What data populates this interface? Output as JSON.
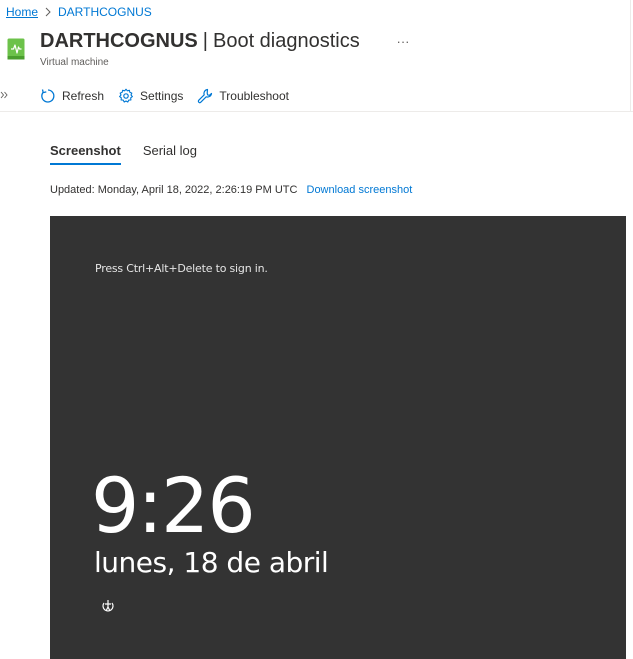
{
  "breadcrumb": {
    "home": "Home",
    "current": "DARTHCOGNUS"
  },
  "header": {
    "resource_name": "DARTHCOGNUS",
    "separator": "|",
    "page_name": "Boot diagnostics",
    "more": "···",
    "subtitle": "Virtual machine"
  },
  "toolbar": {
    "refresh": "Refresh",
    "settings": "Settings",
    "troubleshoot": "Troubleshoot"
  },
  "tabs": [
    {
      "label": "Screenshot",
      "active": true
    },
    {
      "label": "Serial log",
      "active": false
    }
  ],
  "updated": {
    "text": "Updated: Monday, April 18, 2022, 2:26:19 PM UTC",
    "download_label": "Download screenshot"
  },
  "screenshot": {
    "hint": "Press Ctrl+Alt+Delete to sign in.",
    "time": "9:26",
    "date": "lunes, 18 de abril",
    "background": "#333333"
  },
  "colors": {
    "accent": "#0078d4",
    "vm_icon": "#6cc24a"
  },
  "icons": {
    "vm": "virtual-machine-icon",
    "refresh": "refresh-icon",
    "settings": "gear-icon",
    "troubleshoot": "wrench-icon",
    "ease_of_access": "ease-of-access-icon"
  }
}
